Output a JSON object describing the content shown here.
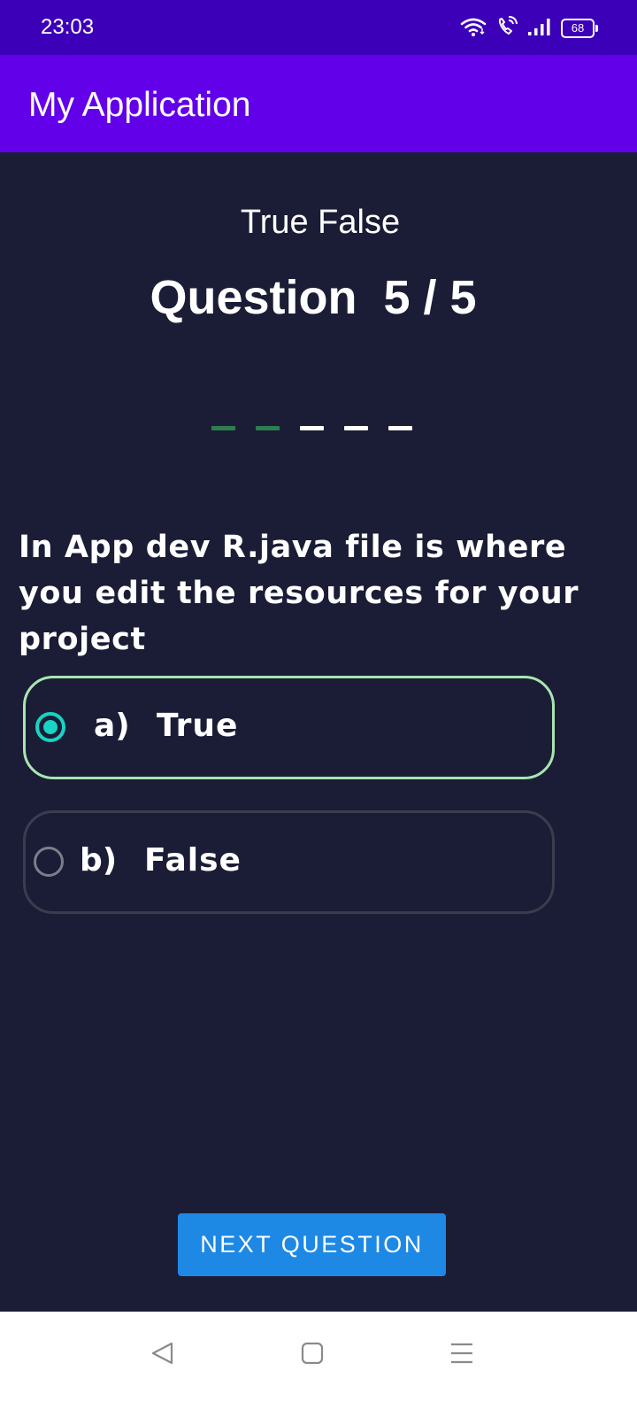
{
  "status_bar": {
    "time": "23:03",
    "battery_level": "68",
    "icons": [
      "wifi-icon",
      "wifi-calling-icon",
      "signal-icon",
      "battery-icon"
    ]
  },
  "app_bar": {
    "title": "My Application"
  },
  "quiz": {
    "type_label": "True False",
    "question_counter": "Question  5 / 5",
    "progress": {
      "total": 5,
      "completed": 2,
      "completed_color": "#2e7d4f",
      "remaining_color": "#ffffff"
    },
    "question_text": "In App dev R.java file is where you edit the resources for your project",
    "options": [
      {
        "letter": "a)",
        "text": "True",
        "selected": true
      },
      {
        "letter": "b)",
        "text": "False",
        "selected": false
      }
    ],
    "next_button_label": "NEXT QUESTION"
  },
  "nav_bar": {
    "icons": [
      "back-icon",
      "home-icon",
      "menu-icon"
    ]
  },
  "colors": {
    "status_bar": "#3c00b8",
    "app_bar": "#6200ea",
    "background": "#1b1d36",
    "selected_border": "#a8e6b0",
    "radio_checked": "#17d4c4",
    "button": "#1e88e5"
  }
}
